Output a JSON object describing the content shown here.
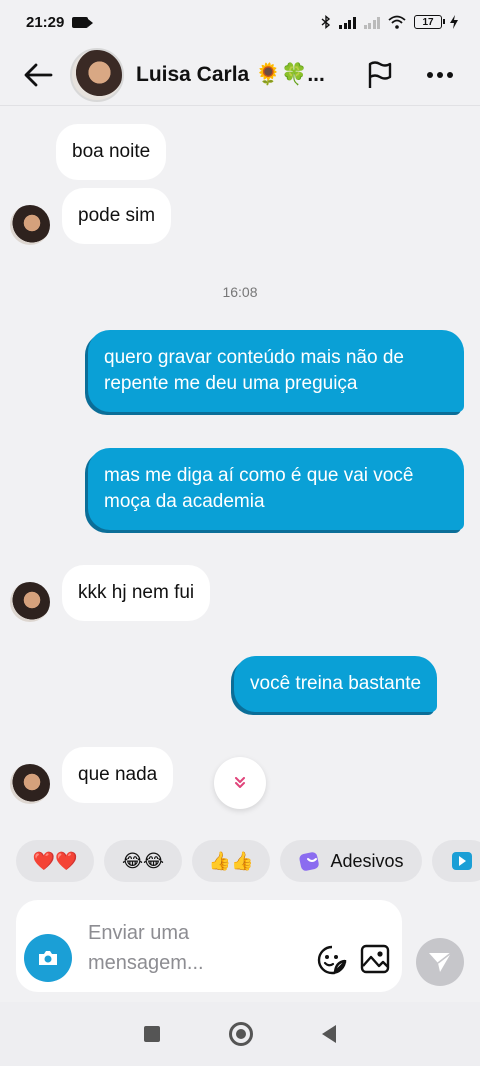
{
  "status_bar": {
    "time": "21:29",
    "battery": "17"
  },
  "header": {
    "contact_name": "Luisa Carla 🌻🍀..."
  },
  "messages": [
    {
      "direction": "in",
      "text": "boa noite"
    },
    {
      "direction": "in",
      "text": "pode sim"
    },
    {
      "direction": "out",
      "text": "quero gravar conteúdo mais não de repente me deu uma preguiça"
    },
    {
      "direction": "out",
      "text": "mas me diga aí como é que vai você moça da academia"
    },
    {
      "direction": "in",
      "text": "kkk hj nem fui"
    },
    {
      "direction": "out",
      "text": "você treina bastante"
    },
    {
      "direction": "in",
      "text": "que nada"
    }
  ],
  "timestamp": "16:08",
  "quick_replies": {
    "hearts": "❤️❤️",
    "laugh": "😂😂",
    "thumbs": "👍👍",
    "stickers": "Adesivos"
  },
  "composer": {
    "placeholder": "Enviar uma mensagem..."
  },
  "colors": {
    "outgoing_bubble": "#0aa0d6",
    "incoming_bubble": "#ffffff",
    "background": "#f1f1f3"
  },
  "icons": {
    "back": "arrow-left-icon",
    "flag": "flag-icon",
    "more": "more-horizontal-icon",
    "camera": "camera-icon",
    "emoji": "sticker-face-icon",
    "gallery": "image-icon",
    "send": "send-icon",
    "scroll_down": "chevron-double-down-icon"
  }
}
